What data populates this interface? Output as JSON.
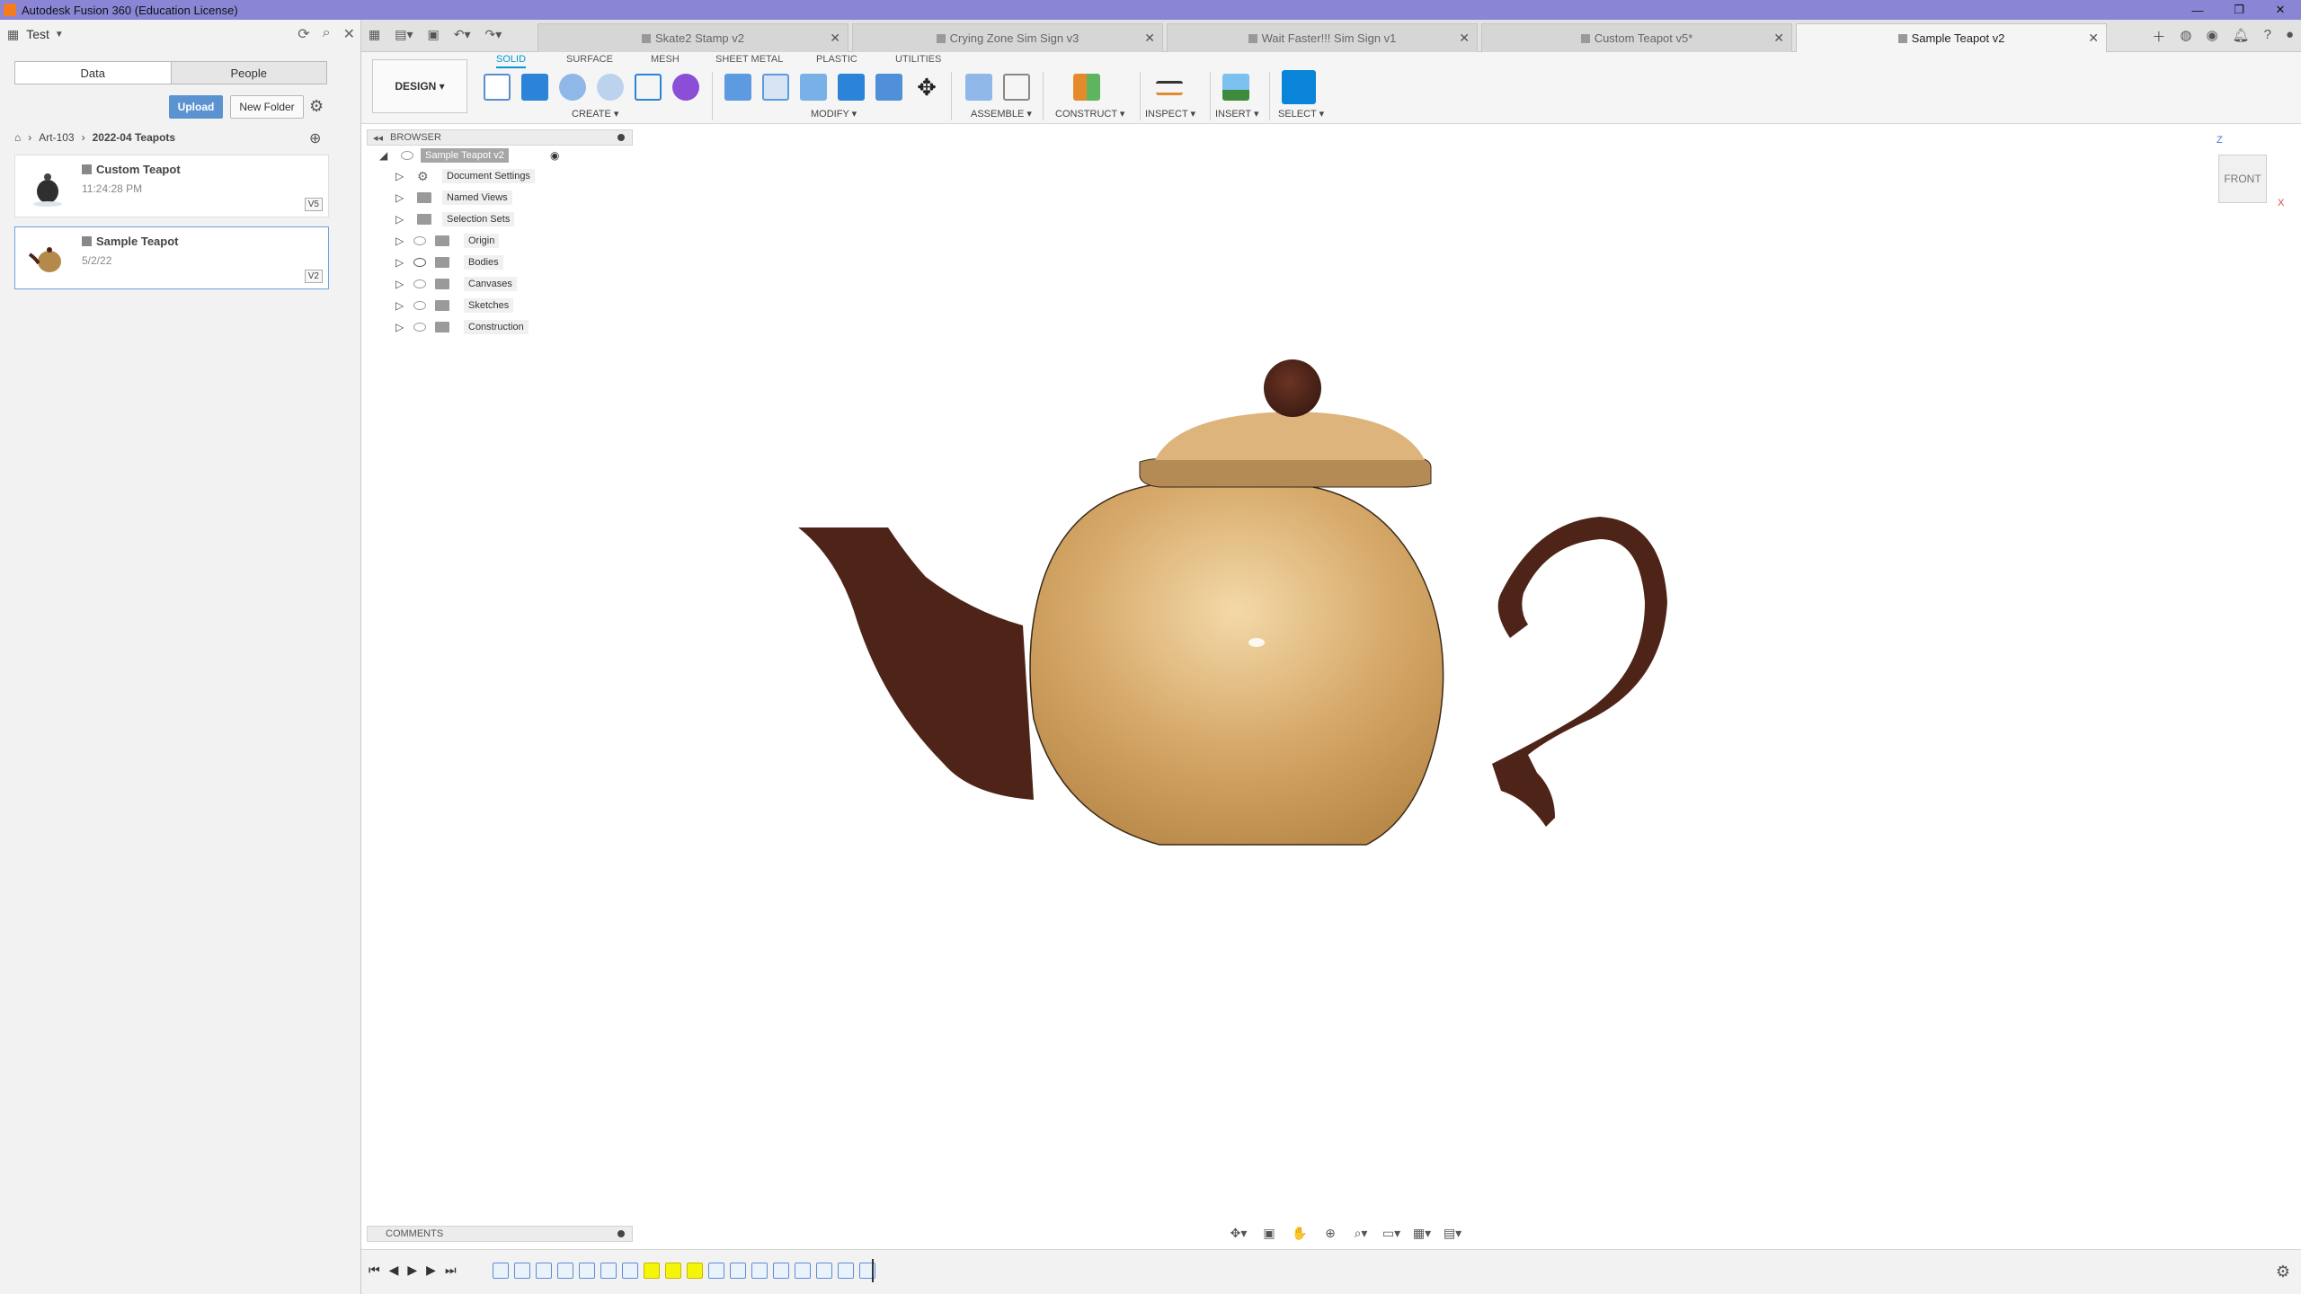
{
  "window": {
    "title": "Autodesk Fusion 360 (Education License)"
  },
  "data_panel": {
    "project": "Test",
    "tabs": [
      "Data",
      "People"
    ],
    "upload_label": "Upload",
    "new_folder_label": "New Folder",
    "breadcrumb": [
      "Art-103",
      "2022-04 Teapots"
    ],
    "files": [
      {
        "name": "Custom Teapot",
        "meta": "11:24:28 PM",
        "version": "V5"
      },
      {
        "name": "Sample Teapot",
        "meta": "5/2/22",
        "version": "V2"
      }
    ]
  },
  "doc_tabs": [
    {
      "label": "Skate2 Stamp v2"
    },
    {
      "label": "Crying Zone Sim Sign v3"
    },
    {
      "label": "Wait Faster!!! Sim Sign v1"
    },
    {
      "label": "Custom Teapot v5*"
    },
    {
      "label": "Sample Teapot v2"
    }
  ],
  "toolbar": {
    "design_label": "DESIGN ▾",
    "workspace_tabs": [
      "SOLID",
      "SURFACE",
      "MESH",
      "SHEET METAL",
      "PLASTIC",
      "UTILITIES"
    ],
    "groups": [
      "CREATE ▾",
      "MODIFY ▾",
      "ASSEMBLE ▾",
      "CONSTRUCT ▾",
      "INSPECT ▾",
      "INSERT ▾",
      "SELECT ▾"
    ]
  },
  "browser": {
    "title": "BROWSER",
    "root": "Sample Teapot v2",
    "items": [
      "Document Settings",
      "Named Views",
      "Selection Sets",
      "Origin",
      "Bodies",
      "Canvases",
      "Sketches",
      "Construction"
    ]
  },
  "viewcube": {
    "face": "FRONT",
    "axis_z": "Z",
    "axis_x": "X"
  },
  "comments": {
    "title": "COMMENTS"
  },
  "colors": {
    "title_bar": "#8b85d6",
    "accent": "#0696d7",
    "teapot_body": "#d6a869",
    "teapot_handle": "#4e2418"
  }
}
